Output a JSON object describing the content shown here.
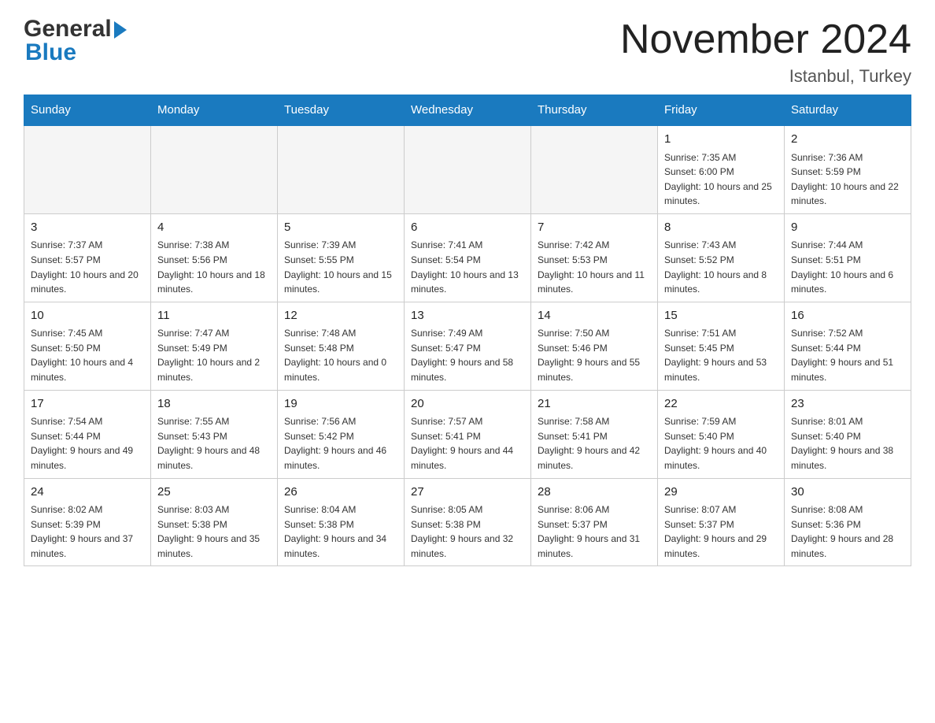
{
  "header": {
    "logo_general": "General",
    "logo_blue": "Blue",
    "month_title": "November 2024",
    "location": "Istanbul, Turkey"
  },
  "calendar": {
    "days_of_week": [
      "Sunday",
      "Monday",
      "Tuesday",
      "Wednesday",
      "Thursday",
      "Friday",
      "Saturday"
    ],
    "weeks": [
      [
        {
          "day": "",
          "info": ""
        },
        {
          "day": "",
          "info": ""
        },
        {
          "day": "",
          "info": ""
        },
        {
          "day": "",
          "info": ""
        },
        {
          "day": "",
          "info": ""
        },
        {
          "day": "1",
          "info": "Sunrise: 7:35 AM\nSunset: 6:00 PM\nDaylight: 10 hours and 25 minutes."
        },
        {
          "day": "2",
          "info": "Sunrise: 7:36 AM\nSunset: 5:59 PM\nDaylight: 10 hours and 22 minutes."
        }
      ],
      [
        {
          "day": "3",
          "info": "Sunrise: 7:37 AM\nSunset: 5:57 PM\nDaylight: 10 hours and 20 minutes."
        },
        {
          "day": "4",
          "info": "Sunrise: 7:38 AM\nSunset: 5:56 PM\nDaylight: 10 hours and 18 minutes."
        },
        {
          "day": "5",
          "info": "Sunrise: 7:39 AM\nSunset: 5:55 PM\nDaylight: 10 hours and 15 minutes."
        },
        {
          "day": "6",
          "info": "Sunrise: 7:41 AM\nSunset: 5:54 PM\nDaylight: 10 hours and 13 minutes."
        },
        {
          "day": "7",
          "info": "Sunrise: 7:42 AM\nSunset: 5:53 PM\nDaylight: 10 hours and 11 minutes."
        },
        {
          "day": "8",
          "info": "Sunrise: 7:43 AM\nSunset: 5:52 PM\nDaylight: 10 hours and 8 minutes."
        },
        {
          "day": "9",
          "info": "Sunrise: 7:44 AM\nSunset: 5:51 PM\nDaylight: 10 hours and 6 minutes."
        }
      ],
      [
        {
          "day": "10",
          "info": "Sunrise: 7:45 AM\nSunset: 5:50 PM\nDaylight: 10 hours and 4 minutes."
        },
        {
          "day": "11",
          "info": "Sunrise: 7:47 AM\nSunset: 5:49 PM\nDaylight: 10 hours and 2 minutes."
        },
        {
          "day": "12",
          "info": "Sunrise: 7:48 AM\nSunset: 5:48 PM\nDaylight: 10 hours and 0 minutes."
        },
        {
          "day": "13",
          "info": "Sunrise: 7:49 AM\nSunset: 5:47 PM\nDaylight: 9 hours and 58 minutes."
        },
        {
          "day": "14",
          "info": "Sunrise: 7:50 AM\nSunset: 5:46 PM\nDaylight: 9 hours and 55 minutes."
        },
        {
          "day": "15",
          "info": "Sunrise: 7:51 AM\nSunset: 5:45 PM\nDaylight: 9 hours and 53 minutes."
        },
        {
          "day": "16",
          "info": "Sunrise: 7:52 AM\nSunset: 5:44 PM\nDaylight: 9 hours and 51 minutes."
        }
      ],
      [
        {
          "day": "17",
          "info": "Sunrise: 7:54 AM\nSunset: 5:44 PM\nDaylight: 9 hours and 49 minutes."
        },
        {
          "day": "18",
          "info": "Sunrise: 7:55 AM\nSunset: 5:43 PM\nDaylight: 9 hours and 48 minutes."
        },
        {
          "day": "19",
          "info": "Sunrise: 7:56 AM\nSunset: 5:42 PM\nDaylight: 9 hours and 46 minutes."
        },
        {
          "day": "20",
          "info": "Sunrise: 7:57 AM\nSunset: 5:41 PM\nDaylight: 9 hours and 44 minutes."
        },
        {
          "day": "21",
          "info": "Sunrise: 7:58 AM\nSunset: 5:41 PM\nDaylight: 9 hours and 42 minutes."
        },
        {
          "day": "22",
          "info": "Sunrise: 7:59 AM\nSunset: 5:40 PM\nDaylight: 9 hours and 40 minutes."
        },
        {
          "day": "23",
          "info": "Sunrise: 8:01 AM\nSunset: 5:40 PM\nDaylight: 9 hours and 38 minutes."
        }
      ],
      [
        {
          "day": "24",
          "info": "Sunrise: 8:02 AM\nSunset: 5:39 PM\nDaylight: 9 hours and 37 minutes."
        },
        {
          "day": "25",
          "info": "Sunrise: 8:03 AM\nSunset: 5:38 PM\nDaylight: 9 hours and 35 minutes."
        },
        {
          "day": "26",
          "info": "Sunrise: 8:04 AM\nSunset: 5:38 PM\nDaylight: 9 hours and 34 minutes."
        },
        {
          "day": "27",
          "info": "Sunrise: 8:05 AM\nSunset: 5:38 PM\nDaylight: 9 hours and 32 minutes."
        },
        {
          "day": "28",
          "info": "Sunrise: 8:06 AM\nSunset: 5:37 PM\nDaylight: 9 hours and 31 minutes."
        },
        {
          "day": "29",
          "info": "Sunrise: 8:07 AM\nSunset: 5:37 PM\nDaylight: 9 hours and 29 minutes."
        },
        {
          "day": "30",
          "info": "Sunrise: 8:08 AM\nSunset: 5:36 PM\nDaylight: 9 hours and 28 minutes."
        }
      ]
    ]
  }
}
